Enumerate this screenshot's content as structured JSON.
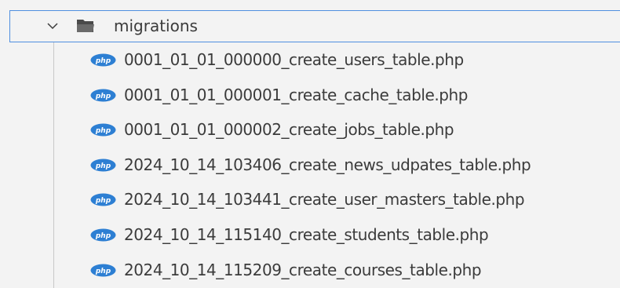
{
  "explorer": {
    "folder": {
      "label": "migrations",
      "expanded": true
    },
    "files": [
      {
        "label": "0001_01_01_000000_create_users_table.php",
        "icon": "php-file-icon"
      },
      {
        "label": "0001_01_01_000001_create_cache_table.php",
        "icon": "php-file-icon"
      },
      {
        "label": "0001_01_01_000002_create_jobs_table.php",
        "icon": "php-file-icon"
      },
      {
        "label": "2024_10_14_103406_create_news_udpates_table.php",
        "icon": "php-file-icon"
      },
      {
        "label": "2024_10_14_103441_create_user_masters_table.php",
        "icon": "php-file-icon"
      },
      {
        "label": "2024_10_14_115140_create_students_table.php",
        "icon": "php-file-icon"
      },
      {
        "label": "2024_10_14_115209_create_courses_table.php",
        "icon": "php-file-icon"
      }
    ],
    "colors": {
      "background": "#f3f3f3",
      "text": "#3b3b3b",
      "focus_border": "#4f8fe0",
      "php_badge": "#2d7fd3",
      "folder_icon": "#4a4a4a"
    }
  }
}
